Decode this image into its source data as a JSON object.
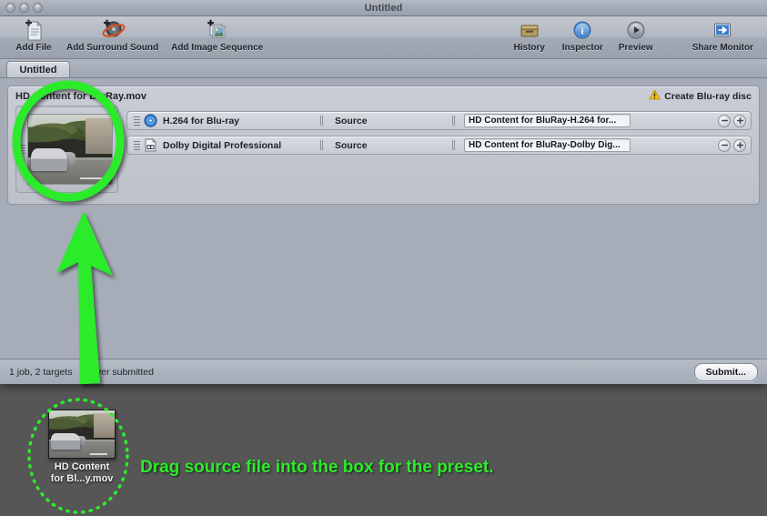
{
  "window": {
    "title": "Untitled",
    "traffic_lights": [
      "close",
      "minimize",
      "zoom"
    ]
  },
  "toolbar": {
    "left_items": [
      {
        "label": "Add File",
        "icon": "add-file-icon"
      },
      {
        "label": "Add Surround Sound",
        "icon": "add-surround-sound-icon"
      },
      {
        "label": "Add Image Sequence",
        "icon": "add-image-sequence-icon"
      }
    ],
    "right_items": [
      {
        "label": "History",
        "icon": "history-icon"
      },
      {
        "label": "Inspector",
        "icon": "inspector-icon"
      },
      {
        "label": "Preview",
        "icon": "preview-icon"
      },
      {
        "label": "Share Monitor",
        "icon": "share-monitor-icon"
      }
    ]
  },
  "tabs": [
    {
      "label": "Untitled",
      "active": true
    }
  ],
  "job": {
    "filename": "HD Content for BluRay.mov",
    "bluray_label": "Create Blu-ray disc",
    "bluray_icon": "warning-icon",
    "thumbnail_name": "job-source-thumbnail",
    "targets": [
      {
        "icon": "h264-disc-icon",
        "name": "H.264 for Blu-ray",
        "source": "Source",
        "destination": "HD Content for BluRay-H.264 for...",
        "remove_label": "−",
        "add_label": "+"
      },
      {
        "icon": "dolby-digital-icon",
        "name": "Dolby Digital Professional",
        "source": "Source",
        "destination": "HD Content for BluRay-Dolby Dig...",
        "remove_label": "−",
        "add_label": "+"
      }
    ]
  },
  "statusbar": {
    "jobs_text": "1 job, 2 targets",
    "submitted_text": "Never submitted",
    "submit_label": "Submit..."
  },
  "annotations": {
    "instruction": "Drag source file into the box for the preset.",
    "accent_color": "#2bec2b",
    "circle_highlight_name": "green-circle-highlight",
    "arrow_name": "green-arrow",
    "dotted_circle_name": "green-dotted-circle"
  },
  "dragged_file": {
    "name_line1": "HD Content",
    "name_line2": "for Bl...y.mov",
    "thumbnail_name": "dragged-file-thumbnail"
  },
  "colors": {
    "desktop": "#565656",
    "window_bg": "#a6adb8",
    "panel_bg": "#c3c7d0",
    "accent_green": "#2bec2b",
    "warning_yellow": "#f3c014",
    "disc_blue": "#2f7fd6"
  }
}
